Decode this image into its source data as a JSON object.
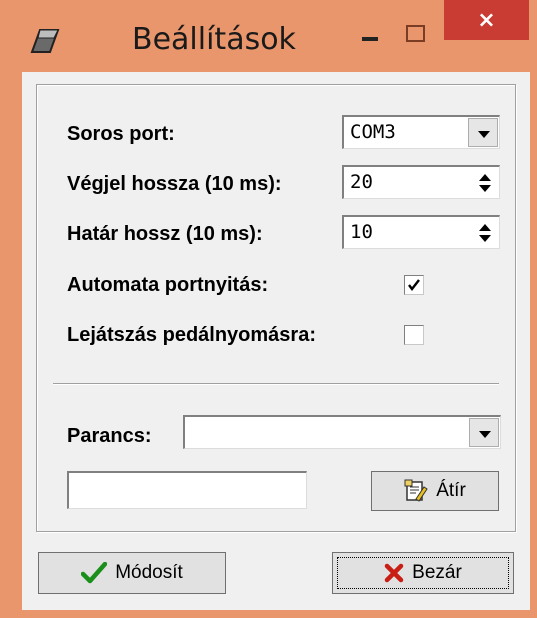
{
  "window": {
    "title": "Beállítások",
    "icon": "pencil-icon",
    "controls": {
      "minimize": "minimize-icon",
      "maximize": "maximize-icon",
      "close": "×"
    }
  },
  "settings": {
    "serial_port_label": "Soros port:",
    "serial_port_value": "COM3",
    "end_signal_label": "Végjel hossza (10 ms):",
    "end_signal_value": "20",
    "limit_label": "Határ hossz (10 ms):",
    "limit_value": "10",
    "auto_open_label": "Automata portnyitás:",
    "auto_open_checked": true,
    "pedal_play_label": "Lejátszás pedálnyomásra:",
    "pedal_play_checked": false
  },
  "command": {
    "label": "Parancs:",
    "value": "",
    "text_value": "",
    "rewrite_label": "Átír",
    "rewrite_icon": "edit-document-icon"
  },
  "footer": {
    "modify_label": "Módosít",
    "modify_icon": "checkmark-icon",
    "close_label": "Bezár",
    "close_icon": "x-icon"
  },
  "colors": {
    "frame": "#e9966c",
    "close_button": "#c83c34",
    "client": "#f0f0f0",
    "check_green": "#1a8f1a",
    "x_red": "#c81e14"
  }
}
